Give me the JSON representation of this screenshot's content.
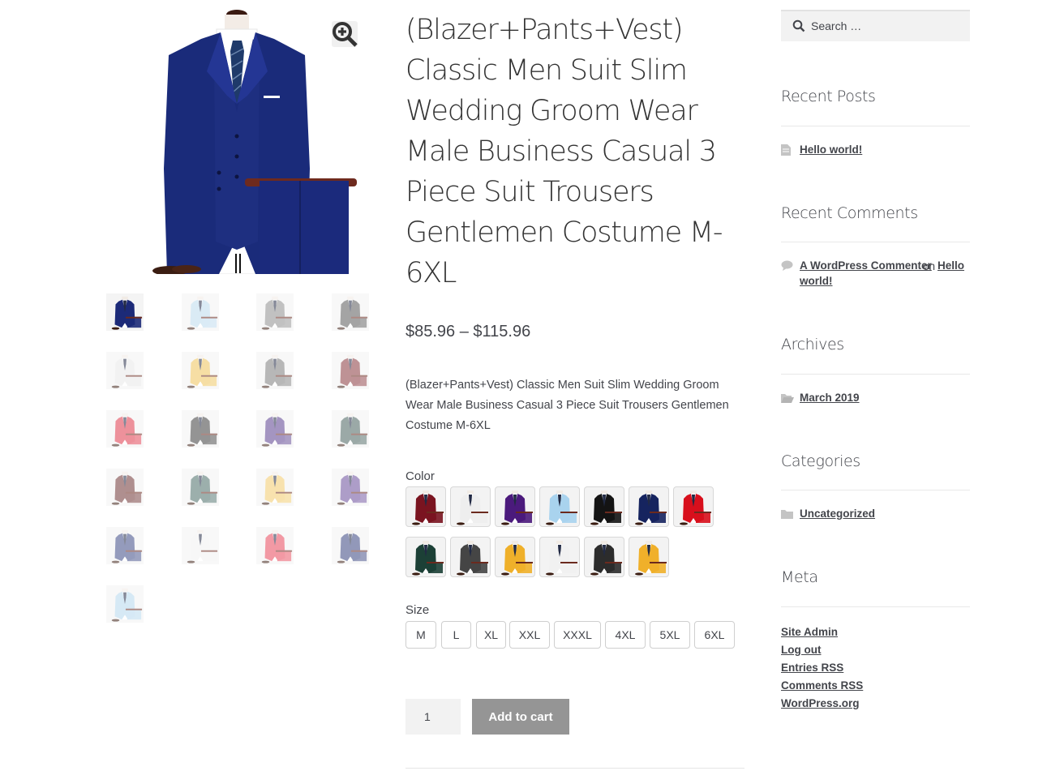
{
  "gallery": {
    "zoom_icon": "magnifier-plus-icon",
    "thumbnails": [
      {
        "color": "#1c2a78",
        "active": true
      },
      {
        "color": "#bcdbee",
        "active": false
      },
      {
        "color": "#8f8f8f",
        "active": false
      },
      {
        "color": "#5a5a5a",
        "active": false
      },
      {
        "color": "#e8e8e8",
        "active": false
      },
      {
        "color": "#f0c45a",
        "active": false
      },
      {
        "color": "#7d7d7d",
        "active": false
      },
      {
        "color": "#8a3a3f",
        "active": false
      },
      {
        "color": "#e0384a",
        "active": false
      },
      {
        "color": "#3e3e3e",
        "active": false
      },
      {
        "color": "#5a3f8f",
        "active": false
      },
      {
        "color": "#4a6460",
        "active": false
      },
      {
        "color": "#6e3434",
        "active": false
      },
      {
        "color": "#4c6e6a",
        "active": false
      },
      {
        "color": "#f3cc6c",
        "active": false
      },
      {
        "color": "#6b4e9c",
        "active": false
      },
      {
        "color": "#3e4a86",
        "active": false
      },
      {
        "color": "#f2f2f2",
        "active": false
      },
      {
        "color": "#e9475a",
        "active": false
      },
      {
        "color": "#3a4580",
        "active": false
      },
      {
        "color": "#b5d8ee",
        "active": false
      }
    ]
  },
  "product": {
    "title": "(Blazer+Pants+Vest) Classic Men Suit Slim Wedding Groom Wear Male Business Casual 3 Piece Suit Trousers Gentlemen Costume M-6XL",
    "price": "$85.96 – $115.96",
    "description": "(Blazer+Pants+Vest) Classic Men Suit Slim Wedding Groom Wear Male Business Casual 3 Piece Suit Trousers Gentlemen Costume M-6XL",
    "color_label": "Color",
    "colors": [
      "#7a1420",
      "#eeeeee",
      "#4b1a7c",
      "#a9d3ee",
      "#141414",
      "#16245f",
      "#d80f1c",
      "#1c4036",
      "#454545",
      "#efb02a",
      "#f1f1f1",
      "#2c2c2c",
      "#f0b02a"
    ],
    "size_label": "Size",
    "sizes": [
      "M",
      "L",
      "XL",
      "XXL",
      "XXXL",
      "4XL",
      "5XL",
      "6XL"
    ],
    "quantity": "1",
    "add_to_cart": "Add to cart"
  },
  "sidebar": {
    "search_placeholder": "Search …",
    "recent_posts": {
      "title": "Recent Posts",
      "items": [
        "Hello world!"
      ]
    },
    "recent_comments": {
      "title": "Recent Comments",
      "author": "A WordPress Commenter",
      "on": "on",
      "post": "Hello world!",
      "post_line1": "Hello",
      "post_line2": "world!"
    },
    "archives": {
      "title": "Archives",
      "items": [
        "March 2019"
      ]
    },
    "categories": {
      "title": "Categories",
      "items": [
        "Uncategorized"
      ]
    },
    "meta": {
      "title": "Meta",
      "items": [
        "Site Admin",
        "Log out",
        "Entries RSS",
        "Comments RSS",
        "WordPress.org"
      ]
    }
  }
}
